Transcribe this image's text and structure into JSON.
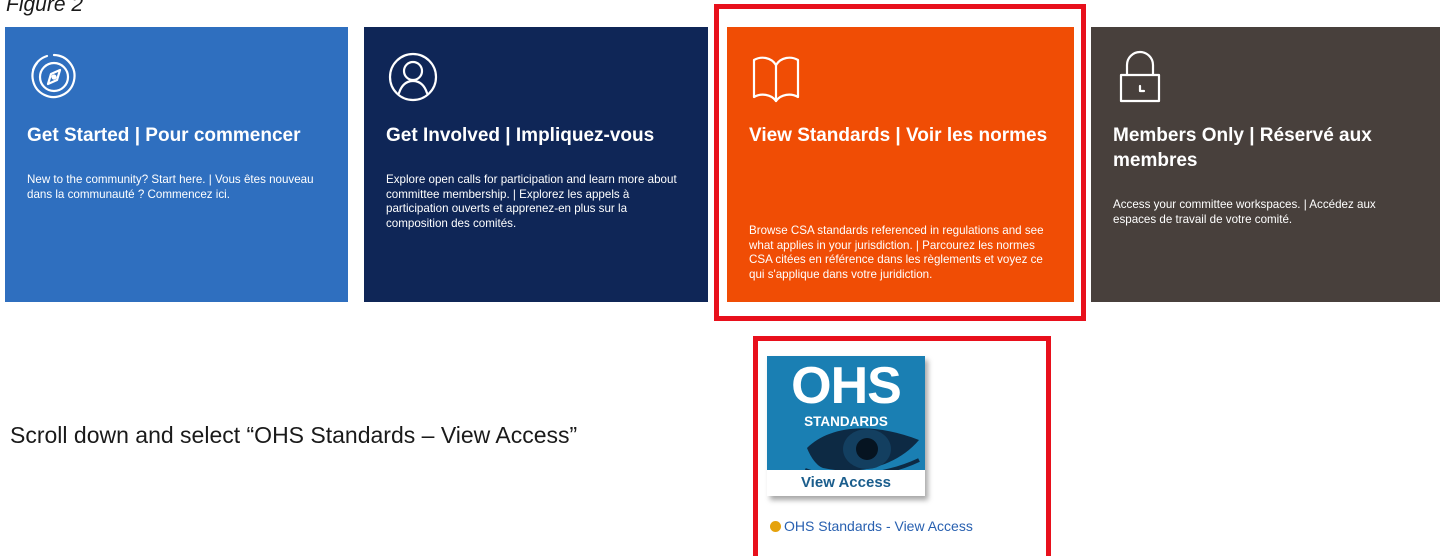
{
  "figure_label": "Figure 2",
  "tiles": [
    {
      "title": "Get Started | Pour commencer",
      "description": "New to the community? Start here. | Vous êtes nouveau dans la communauté ? Commencez ici.",
      "icon": "compass-icon",
      "color": "#2f6fbf"
    },
    {
      "title": "Get Involved | Impliquez-vous",
      "description": "Explore open calls for participation and learn more about committee membership. | Explorez les appels à participation ouverts et apprenez-en plus sur la composition des comités.",
      "icon": "user-icon",
      "color": "#0f2657"
    },
    {
      "title": "View Standards | Voir les normes",
      "description": "Browse CSA standards referenced in regulations and see what applies in your jurisdiction. | Parcourez les normes CSA citées en référence dans les règlements et voyez ce qui s'applique dans votre juridiction.",
      "icon": "book-icon",
      "color": "#f04d05"
    },
    {
      "title": "Members Only | Réservé aux membres",
      "description": "Access your committee workspaces. | Accédez aux espaces de travail de votre comité.",
      "icon": "lock-icon",
      "color": "#48403c"
    }
  ],
  "instruction": "Scroll down and select “OHS Standards – View Access”",
  "ohs_tile": {
    "logo_main": "OHS",
    "logo_sub": "STANDARDS",
    "logo_caption": "View Access",
    "link_text": "OHS Standards -  View Access",
    "logo_color": "#1a7fb3"
  },
  "highlight_color": "#e8101c"
}
